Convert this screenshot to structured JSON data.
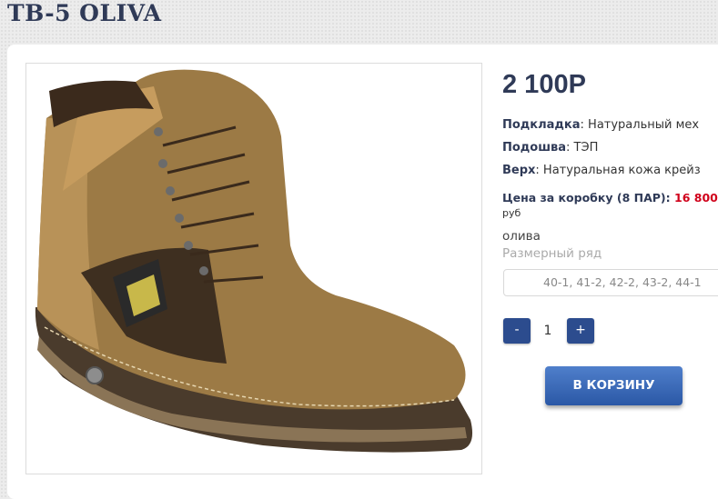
{
  "product": {
    "title": "TB-5 OLIVA",
    "price": "2 100Р",
    "props": [
      {
        "label": "Подкладка",
        "value": ": Натуральный мех"
      },
      {
        "label": "Подошва",
        "value": ": ТЭП"
      },
      {
        "label": "Верх",
        "value": ": Натуральная кожа крейз"
      }
    ],
    "box_price": {
      "label": "Цена за коробку (8 ПАР):",
      "value": "16 800",
      "unit": "руб"
    },
    "color": "олива",
    "size_label": "Размерный ряд",
    "sizes": "40-1, 41-2, 42-2, 43-2, 44-1"
  },
  "quantity": {
    "minus": "-",
    "value": "1",
    "plus": "+"
  },
  "cart_button": "В КОРЗИНУ",
  "colors": {
    "accent": "#2c4c8e",
    "title": "#2f3a57",
    "price_red": "#d0021b"
  }
}
